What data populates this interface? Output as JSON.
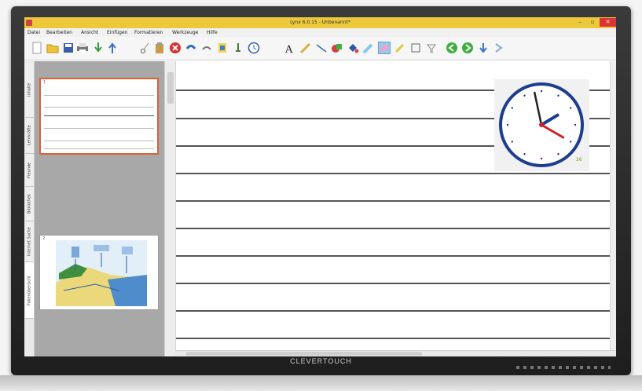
{
  "window": {
    "title": "Lynx 6.0.15 - Unbenannt*",
    "min": "–",
    "max": "▫",
    "close": "✕"
  },
  "menu": [
    "Datei",
    "Bearbeiten",
    "Ansicht",
    "Einfügen",
    "Formatieren",
    "Werkzeuge",
    "Hilfe"
  ],
  "sidetabs": [
    "Folienübersicht",
    "Internet Suche",
    "Bibliothek",
    "Freunde",
    "Lehrkräfte",
    "Inhalte"
  ],
  "slides": [
    {
      "number": "1",
      "selected": true
    },
    {
      "number": "2",
      "selected": false
    }
  ],
  "toolbar_icons": [
    "new-page-icon",
    "open-folder-icon",
    "save-icon",
    "print-icon",
    "import-icon",
    "export-icon",
    "cut-icon",
    "paste-icon",
    "delete-icon",
    "undo-icon",
    "redo-icon",
    "insert-page-icon",
    "screen-capture-icon",
    "clock-icon",
    "text-tool-icon",
    "pen-tool-icon",
    "line-tool-icon",
    "shape-tool-icon",
    "fill-tool-icon",
    "highlighter-icon",
    "eraser-icon",
    "selection-tool-icon",
    "crop-icon",
    "next-slide-icon",
    "prev-slide-icon",
    "add-slide-icon",
    "more-icon"
  ],
  "clock": {
    "hour": 1,
    "minute": 58,
    "second": 20,
    "date": "26"
  },
  "brand": "CLEVERTOUCH",
  "colors": {
    "titlebar": "#ecc83a",
    "selection_border": "#d9623a",
    "clock_rim": "#1f3d8f",
    "second_hand": "#d12020"
  }
}
